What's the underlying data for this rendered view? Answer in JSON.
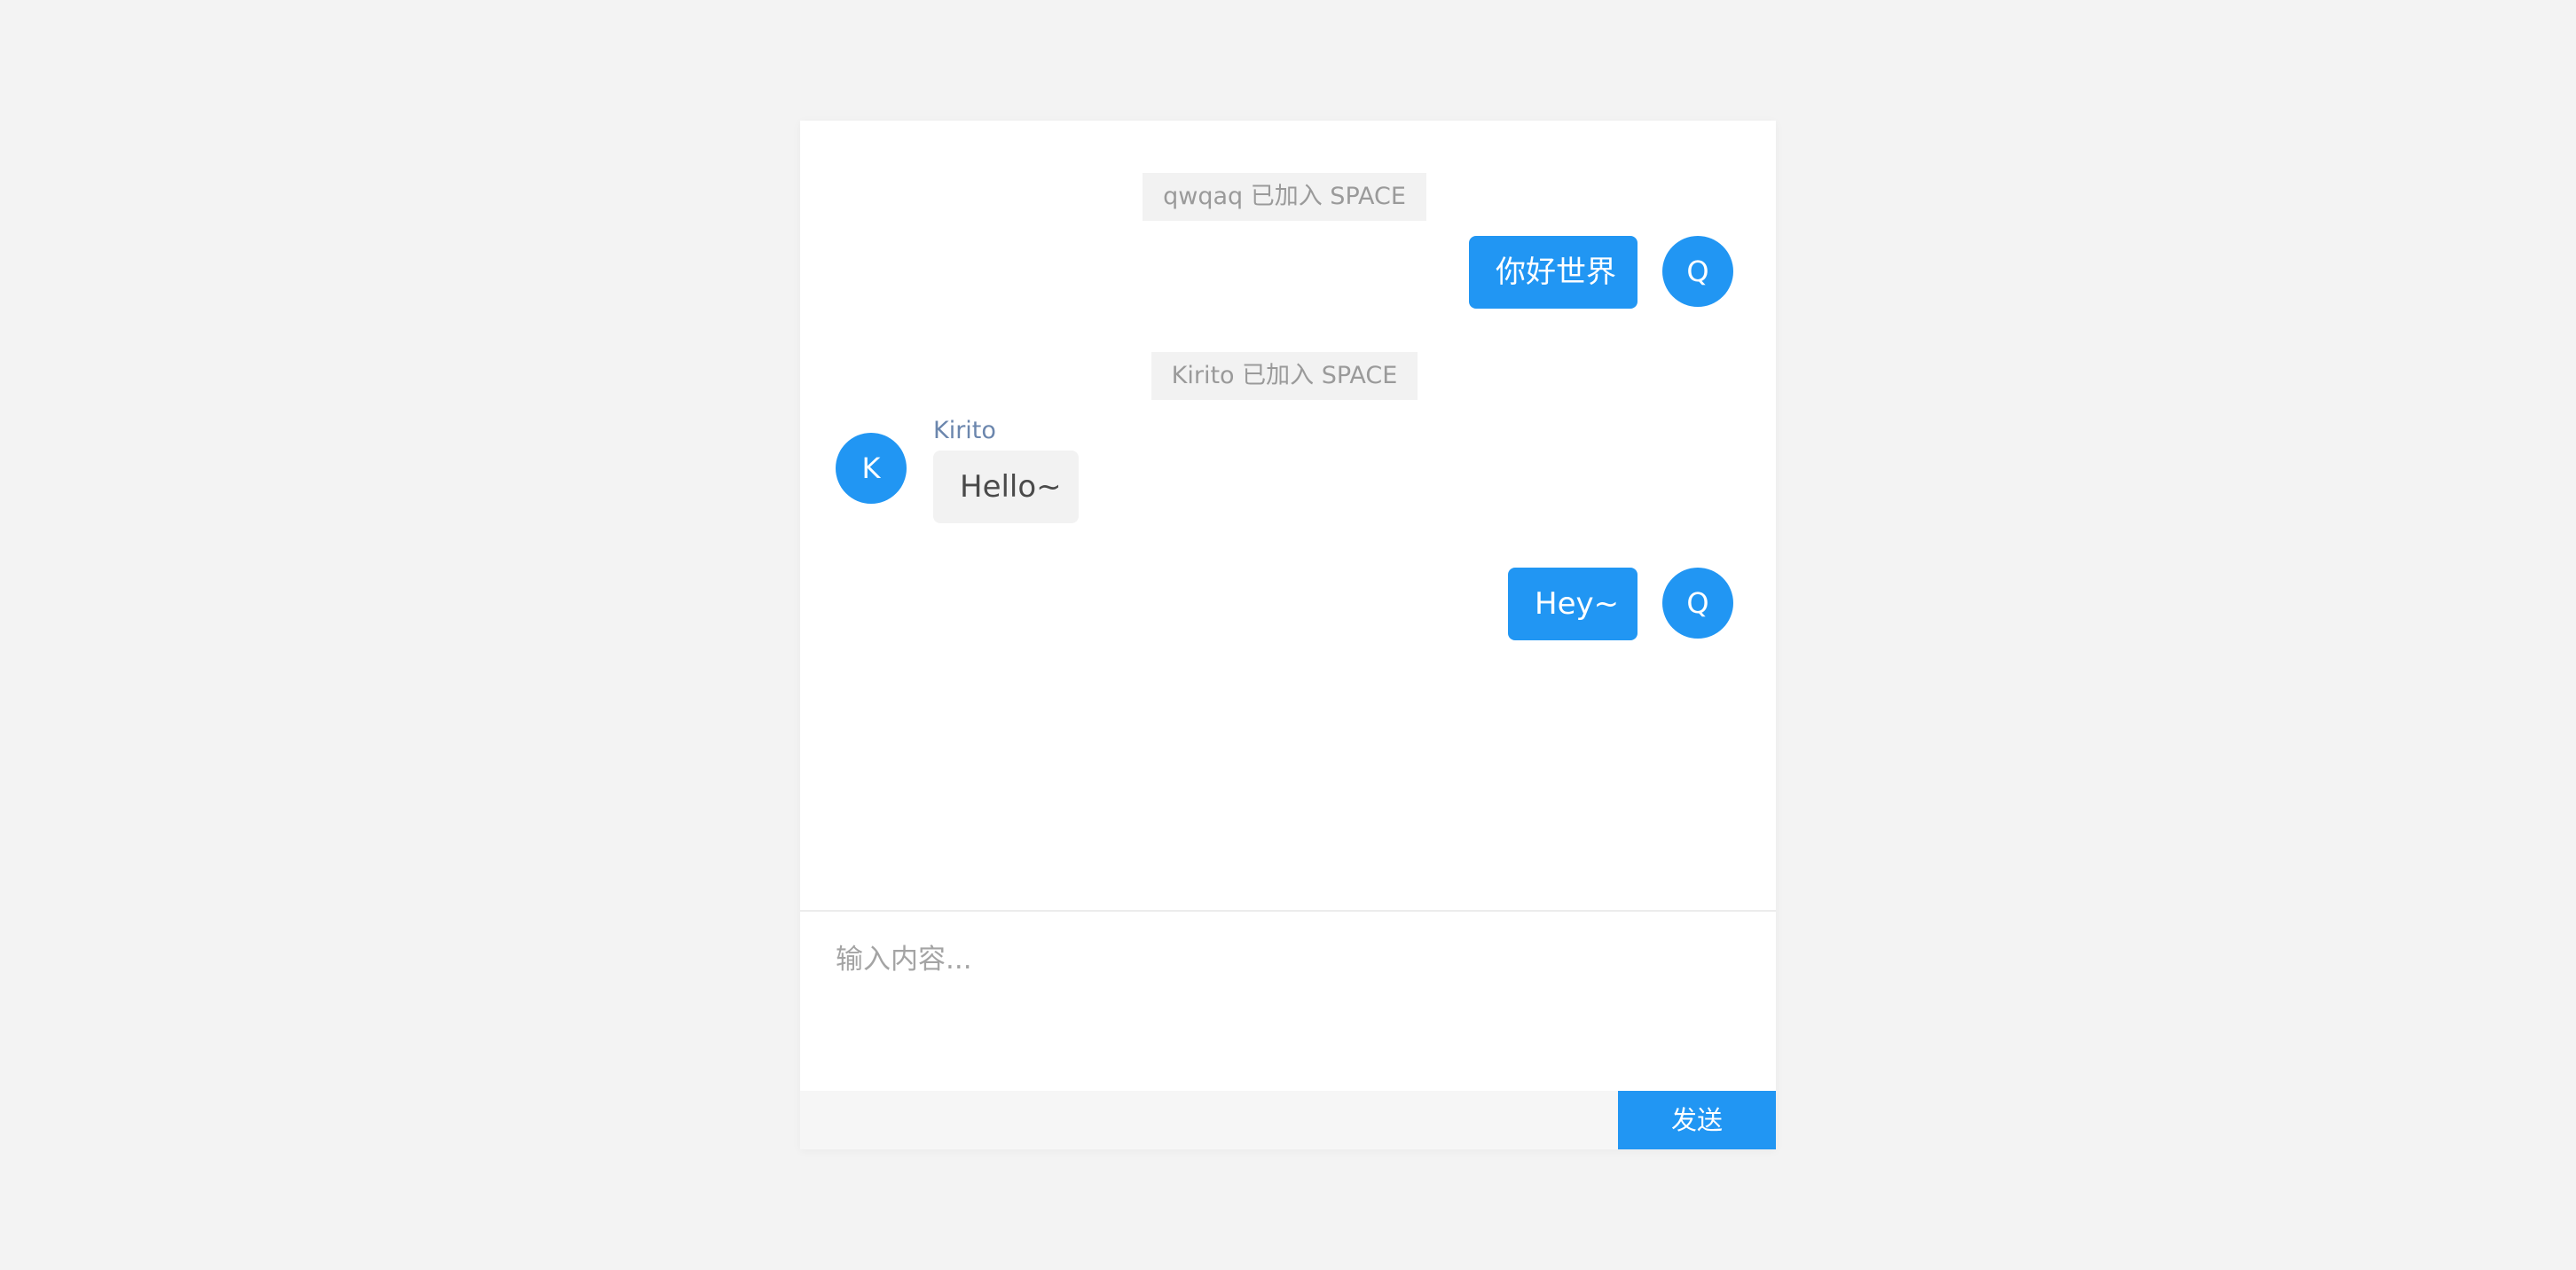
{
  "messages": {
    "notice_1": "qwqaq 已加入 SPACE",
    "self_message_1": {
      "text": "你好世界",
      "avatar_letter": "Q"
    },
    "notice_2": "Kirito 已加入 SPACE",
    "other_message_1": {
      "sender": "Kirito",
      "text": "Hello~",
      "avatar_letter": "K"
    },
    "self_message_2": {
      "text": "Hey~",
      "avatar_letter": "Q"
    }
  },
  "input": {
    "placeholder": "输入内容..."
  },
  "send_button": {
    "label": "发送"
  },
  "colors": {
    "accent": "#2196f3",
    "page_background": "#f3f3f3",
    "notice_background": "#f2f2f2",
    "sender_name": "#6b86ad"
  }
}
